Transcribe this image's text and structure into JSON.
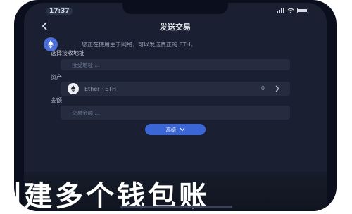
{
  "status": {
    "time": "17:37"
  },
  "nav": {
    "title": "发送交易"
  },
  "notice": {
    "text": "您正在使用主于网络，可以发送真正的 ETH。"
  },
  "recipient": {
    "label": "选择接收地址",
    "placeholder": "接受地址 ..."
  },
  "asset": {
    "label": "资产",
    "name": "Ether · ETH",
    "balance": "0"
  },
  "amount": {
    "label": "金额",
    "placeholder": "交易金额 ..."
  },
  "advanced": {
    "label": "高级"
  },
  "caption": {
    "text": "创建多个钱包账"
  },
  "colors": {
    "accent": "#3a66d6",
    "background": "#1a2031",
    "field": "#252c40"
  },
  "icons": [
    "back-arrow-icon",
    "ethereum-icon",
    "chevron-right-icon",
    "chevron-down-icon",
    "signal-icon",
    "wifi-icon",
    "battery-icon"
  ]
}
